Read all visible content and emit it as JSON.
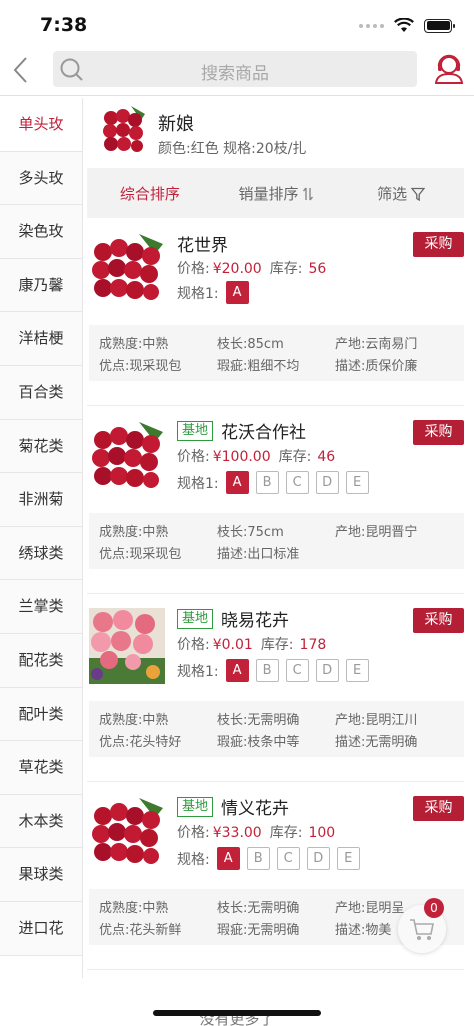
{
  "status_bar": {
    "time": "7:38"
  },
  "header": {
    "search_placeholder": "搜索商品"
  },
  "sidebar": {
    "items": [
      {
        "label": "单头玫",
        "active": true
      },
      {
        "label": "多头玫"
      },
      {
        "label": "染色玫"
      },
      {
        "label": "康乃馨"
      },
      {
        "label": "洋桔梗"
      },
      {
        "label": "百合类"
      },
      {
        "label": "菊花类"
      },
      {
        "label": "非洲菊"
      },
      {
        "label": "绣球类"
      },
      {
        "label": "兰掌类"
      },
      {
        "label": "配花类"
      },
      {
        "label": "配叶类"
      },
      {
        "label": "草花类"
      },
      {
        "label": "木本类"
      },
      {
        "label": "果球类"
      },
      {
        "label": "进口花"
      }
    ]
  },
  "top_product": {
    "name": "新娘",
    "spec": "颜色:红色   规格:20枝/扎"
  },
  "sort_bar": {
    "overall": "综合排序",
    "sales": "销量排序",
    "filter": "筛选"
  },
  "products": [
    {
      "badge": "",
      "name": "花世界",
      "price_label": "价格:",
      "price": "¥20.00",
      "stock_label": "库存:",
      "stock": "56",
      "spec_label": "规格1:",
      "specs": [
        "A"
      ],
      "buy": "采购",
      "attrs": [
        [
          "成熟度:中熟",
          "枝长:85cm",
          "产地:云南易门"
        ],
        [
          "优点:现采现包",
          "瑕疵:粗细不均",
          "描述:质保价廉"
        ]
      ]
    },
    {
      "badge": "基地",
      "name": "花沃合作社",
      "price_label": "价格:",
      "price": "¥100.00",
      "stock_label": "库存:",
      "stock": "46",
      "spec_label": "规格1:",
      "specs": [
        "A",
        "B",
        "C",
        "D",
        "E"
      ],
      "buy": "采购",
      "attrs": [
        [
          "成熟度:中熟",
          "枝长:75cm",
          "产地:昆明晋宁"
        ],
        [
          "优点:现采现包",
          "描述:出口标准",
          ""
        ]
      ]
    },
    {
      "badge": "基地",
      "name": "晓易花卉",
      "price_label": "价格:",
      "price": "¥0.01",
      "stock_label": "库存:",
      "stock": "178",
      "spec_label": "规格1:",
      "specs": [
        "A",
        "B",
        "C",
        "D",
        "E"
      ],
      "buy": "采购",
      "attrs": [
        [
          "成熟度:中熟",
          "枝长:无需明确",
          "产地:昆明江川"
        ],
        [
          "优点:花头特好",
          "瑕疵:枝条中等",
          "描述:无需明确"
        ]
      ]
    },
    {
      "badge": "基地",
      "name": "情义花卉",
      "price_label": "价格:",
      "price": "¥33.00",
      "stock_label": "库存:",
      "stock": "100",
      "spec_label": "规格:",
      "specs": [
        "A",
        "B",
        "C",
        "D",
        "E"
      ],
      "buy": "采购",
      "attrs": [
        [
          "成熟度:中熟",
          "枝长:无需明确",
          "产地:昆明呈"
        ],
        [
          "优点:花头新鲜",
          "瑕疵:无需明确",
          "描述:物美"
        ]
      ]
    }
  ],
  "footer": {
    "no_more": "没有更多了"
  },
  "cart": {
    "count": "0"
  },
  "colors": {
    "accent": "#c1223a",
    "base_badge": "#2e9b3e"
  }
}
